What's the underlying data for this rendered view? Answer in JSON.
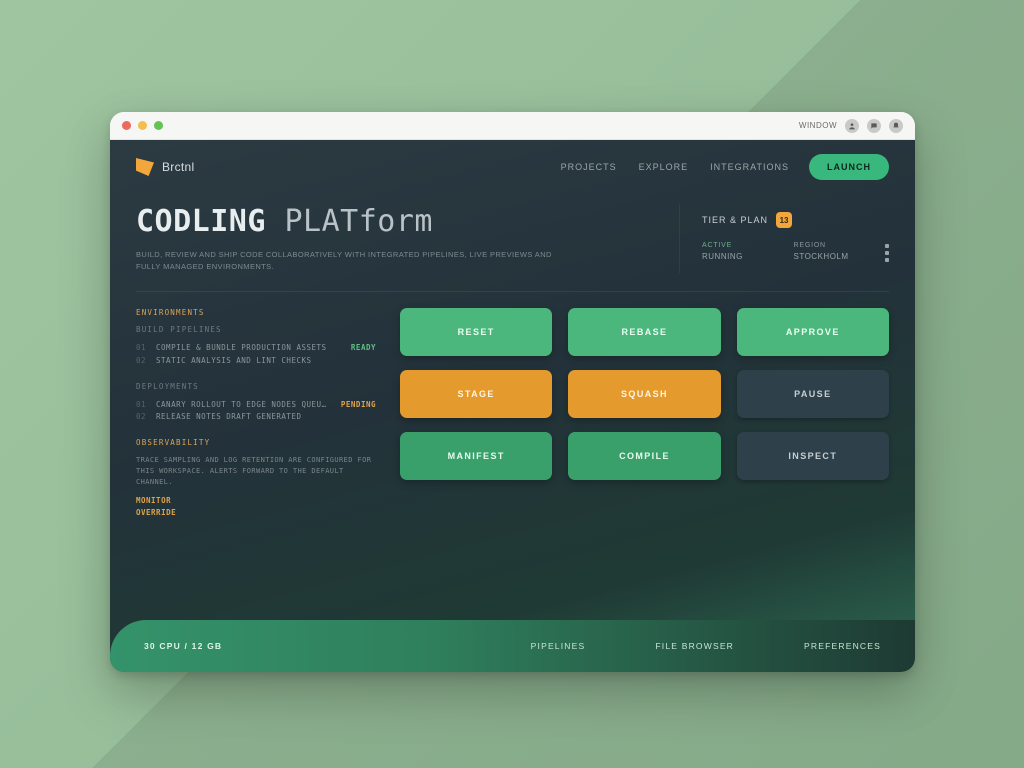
{
  "titlebar": {
    "menu_label": "Window",
    "icons": [
      "user",
      "chat",
      "bell"
    ]
  },
  "brand": {
    "name": "Brctnl"
  },
  "nav": {
    "items": [
      "Projects",
      "Explore",
      "Integrations"
    ],
    "cta": "Launch"
  },
  "hero": {
    "title_strong": "CODLING",
    "title_light": "PLATform",
    "subtitle": "Build, review and ship code collaboratively with integrated pipelines, live previews and fully managed environments."
  },
  "status": {
    "label": "Tier & Plan",
    "badge": "13",
    "metrics": [
      {
        "label": "Active",
        "value": "Running"
      },
      {
        "label": "Region",
        "value": "Stockholm"
      }
    ]
  },
  "list": {
    "heading": "Environments",
    "section1": {
      "label": "Build Pipelines",
      "lines": [
        {
          "bullet": "01",
          "txt": "Compile & bundle production assets",
          "tag": "Ready",
          "tag_kind": "green"
        },
        {
          "bullet": "02",
          "txt": "Static analysis and lint checks"
        }
      ]
    },
    "section2": {
      "label": "Deployments",
      "lines": [
        {
          "bullet": "01",
          "txt": "Canary rollout to edge nodes queued",
          "tag": "Pending",
          "tag_kind": "amber"
        },
        {
          "bullet": "02",
          "txt": "Release notes draft generated"
        }
      ]
    },
    "section3": {
      "label": "Observability",
      "desc": "Trace sampling and log retention are configured for this workspace. Alerts forward to the default channel.",
      "tag": "Monitor",
      "tag2": "Override"
    }
  },
  "cards": [
    {
      "label": "Reset",
      "variant": "green"
    },
    {
      "label": "Rebase",
      "variant": "green"
    },
    {
      "label": "Approve",
      "variant": "green"
    },
    {
      "label": "Stage",
      "variant": "amber"
    },
    {
      "label": "Squash",
      "variant": "amber"
    },
    {
      "label": "Pause",
      "variant": "dark"
    },
    {
      "label": "Manifest",
      "variant": "green2"
    },
    {
      "label": "Compile",
      "variant": "green2"
    },
    {
      "label": "Inspect",
      "variant": "dark"
    }
  ],
  "footer": {
    "left": "30 CPU / 12 GB",
    "links": [
      "Pipelines",
      "File Browser",
      "Preferences"
    ]
  }
}
